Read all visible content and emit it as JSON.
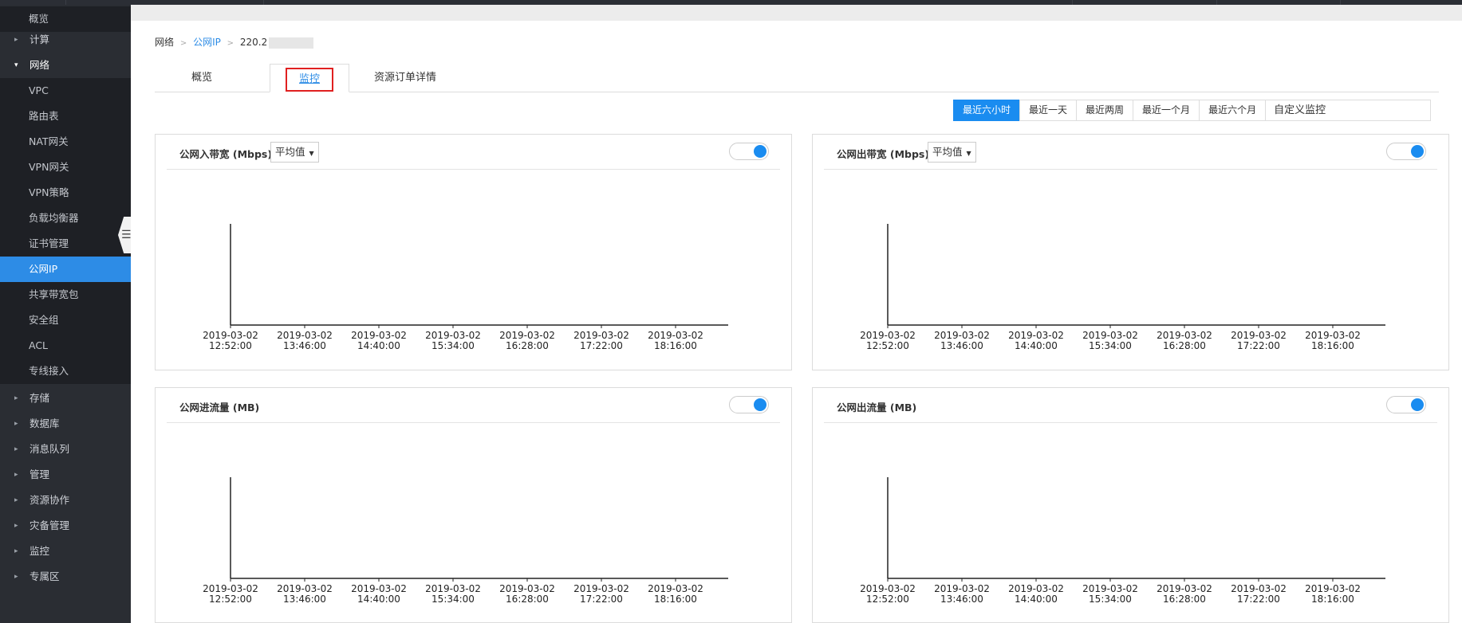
{
  "sidebar": {
    "items": [
      {
        "label": "概览",
        "kind": "sub"
      },
      {
        "label": "计算",
        "kind": "top",
        "caret": "▸"
      },
      {
        "label": "网络",
        "kind": "top",
        "caret": "▾",
        "expanded": true
      },
      {
        "label": "VPC",
        "kind": "sub"
      },
      {
        "label": "路由表",
        "kind": "sub"
      },
      {
        "label": "NAT网关",
        "kind": "sub"
      },
      {
        "label": "VPN网关",
        "kind": "sub"
      },
      {
        "label": "VPN策略",
        "kind": "sub"
      },
      {
        "label": "负载均衡器",
        "kind": "sub"
      },
      {
        "label": "证书管理",
        "kind": "sub"
      },
      {
        "label": "公网IP",
        "kind": "sub",
        "active": true
      },
      {
        "label": "共享带宽包",
        "kind": "sub"
      },
      {
        "label": "安全组",
        "kind": "sub"
      },
      {
        "label": "ACL",
        "kind": "sub"
      },
      {
        "label": "专线接入",
        "kind": "sub"
      },
      {
        "label": "存储",
        "kind": "top",
        "caret": "▸"
      },
      {
        "label": "数据库",
        "kind": "top",
        "caret": "▸"
      },
      {
        "label": "消息队列",
        "kind": "top",
        "caret": "▸"
      },
      {
        "label": "管理",
        "kind": "top",
        "caret": "▸"
      },
      {
        "label": "资源协作",
        "kind": "top",
        "caret": "▸"
      },
      {
        "label": "灾备管理",
        "kind": "top",
        "caret": "▸"
      },
      {
        "label": "监控",
        "kind": "top",
        "caret": "▸"
      },
      {
        "label": "专属区",
        "kind": "top",
        "caret": "▸"
      }
    ],
    "collapse_glyph": "☰"
  },
  "breadcrumb": {
    "root": "网络",
    "section": "公网IP",
    "current": "220.2",
    "sep": ">"
  },
  "tabs": [
    {
      "label": "概览"
    },
    {
      "label": "监控",
      "active": true
    },
    {
      "label": "资源订单详情"
    }
  ],
  "time_ranges": {
    "options": [
      "最近六小时",
      "最近一天",
      "最近两周",
      "最近一个月",
      "最近六个月"
    ],
    "active_index": 0,
    "custom_label": "自定义监控"
  },
  "panels": [
    {
      "title": "公网入带宽 (Mbps)",
      "select": "平均值",
      "toggle_on": true
    },
    {
      "title": "公网出带宽 (Mbps)",
      "select": "平均值",
      "toggle_on": true
    },
    {
      "title": "公网进流量 (MB)",
      "select": null,
      "toggle_on": true
    },
    {
      "title": "公网出流量 (MB)",
      "select": null,
      "toggle_on": true
    }
  ],
  "accent_color": "#1a8cf0",
  "chart_data": [
    {
      "type": "line",
      "title": "公网入带宽 (Mbps)",
      "series": [],
      "x_ticks": [
        [
          "2019-03-02",
          "12:52:00"
        ],
        [
          "2019-03-02",
          "13:46:00"
        ],
        [
          "2019-03-02",
          "14:40:00"
        ],
        [
          "2019-03-02",
          "15:34:00"
        ],
        [
          "2019-03-02",
          "16:28:00"
        ],
        [
          "2019-03-02",
          "17:22:00"
        ],
        [
          "2019-03-02",
          "18:16:00"
        ]
      ]
    },
    {
      "type": "line",
      "title": "公网出带宽 (Mbps)",
      "series": [],
      "x_ticks": [
        [
          "2019-03-02",
          "12:52:00"
        ],
        [
          "2019-03-02",
          "13:46:00"
        ],
        [
          "2019-03-02",
          "14:40:00"
        ],
        [
          "2019-03-02",
          "15:34:00"
        ],
        [
          "2019-03-02",
          "16:28:00"
        ],
        [
          "2019-03-02",
          "17:22:00"
        ],
        [
          "2019-03-02",
          "18:16:00"
        ]
      ]
    },
    {
      "type": "line",
      "title": "公网进流量 (MB)",
      "series": [],
      "x_ticks": [
        [
          "2019-03-02",
          "12:52:00"
        ],
        [
          "2019-03-02",
          "13:46:00"
        ],
        [
          "2019-03-02",
          "14:40:00"
        ],
        [
          "2019-03-02",
          "15:34:00"
        ],
        [
          "2019-03-02",
          "16:28:00"
        ],
        [
          "2019-03-02",
          "17:22:00"
        ],
        [
          "2019-03-02",
          "18:16:00"
        ]
      ]
    },
    {
      "type": "line",
      "title": "公网出流量 (MB)",
      "series": [],
      "x_ticks": [
        [
          "2019-03-02",
          "12:52:00"
        ],
        [
          "2019-03-02",
          "13:46:00"
        ],
        [
          "2019-03-02",
          "14:40:00"
        ],
        [
          "2019-03-02",
          "15:34:00"
        ],
        [
          "2019-03-02",
          "16:28:00"
        ],
        [
          "2019-03-02",
          "17:22:00"
        ],
        [
          "2019-03-02",
          "18:16:00"
        ]
      ]
    }
  ]
}
